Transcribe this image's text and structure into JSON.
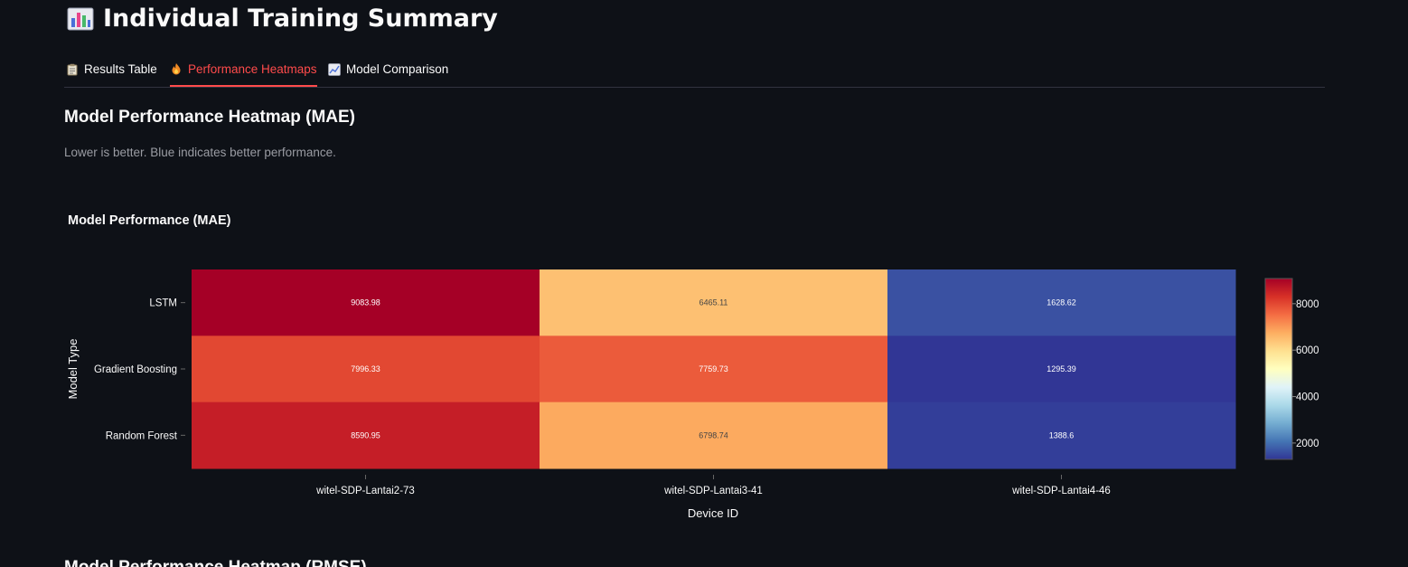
{
  "header": {
    "title": "Individual Training Summary",
    "icon": "bar-chart-icon"
  },
  "tabs": [
    {
      "label": "Results Table",
      "icon": "clipboard-icon",
      "active": false
    },
    {
      "label": "Performance Heatmaps",
      "icon": "fire-icon",
      "active": true
    },
    {
      "label": "Model Comparison",
      "icon": "line-chart-icon",
      "active": false
    }
  ],
  "section": {
    "title": "Model Performance Heatmap (MAE)",
    "caption": "Lower is better. Blue indicates better performance."
  },
  "next_section": {
    "title": "Model Performance Heatmap (RMSE)"
  },
  "colors": {
    "background": "#0e1117",
    "accent": "#ff4b4b",
    "text": "#fafafa",
    "muted": "#9a9ca3",
    "colorscale": "RdYlBu (reversed)"
  },
  "chart_data": {
    "type": "heatmap",
    "title": "Model Performance (MAE)",
    "xlabel": "Device ID",
    "ylabel": "Model Type",
    "x": [
      "witel-SDP-Lantai2-73",
      "witel-SDP-Lantai3-41",
      "witel-SDP-Lantai4-46"
    ],
    "y": [
      "LSTM",
      "Gradient Boosting",
      "Random Forest"
    ],
    "values": [
      [
        9083.98,
        6465.11,
        1628.62
      ],
      [
        7996.33,
        7759.73,
        1295.39
      ],
      [
        8590.95,
        6798.74,
        1388.6
      ]
    ],
    "value_labels": [
      [
        "9083.98",
        "6465.11",
        "1628.62"
      ],
      [
        "7996.33",
        "7759.73",
        "1295.39"
      ],
      [
        "8590.95",
        "6798.74",
        "1388.6"
      ]
    ],
    "zmin": 1295.39,
    "zmax": 9083.98,
    "colorbar_ticks": [
      2000,
      4000,
      6000,
      8000
    ],
    "colorbar_tick_labels": [
      "2000",
      "4000",
      "6000",
      "8000"
    ]
  }
}
